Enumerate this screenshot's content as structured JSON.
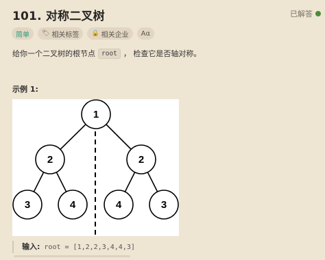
{
  "problem": {
    "title": "101. 对称二叉树",
    "status": "已解答"
  },
  "tags": [
    {
      "label": "简单",
      "icon": null
    },
    {
      "label": "相关标签",
      "icon": "tag-icon"
    },
    {
      "label": "相关企业",
      "icon": "lock-icon"
    },
    {
      "label": "Aα",
      "icon": null
    }
  ],
  "description": {
    "before": "给你一个二叉树的根节点",
    "code": "root",
    "after": "， 检查它是否轴对称。"
  },
  "example": {
    "title": "示例 1:",
    "input_label": "输入:",
    "input_value": "root = [1,2,2,3,4,4,3]"
  },
  "tree": {
    "nodes": [
      "1",
      "2",
      "2",
      "3",
      "4",
      "4",
      "3"
    ]
  },
  "colors": {
    "background": "#efe5d3",
    "easy": "#2a9d7e",
    "solved_dot": "#4b8b3b"
  }
}
